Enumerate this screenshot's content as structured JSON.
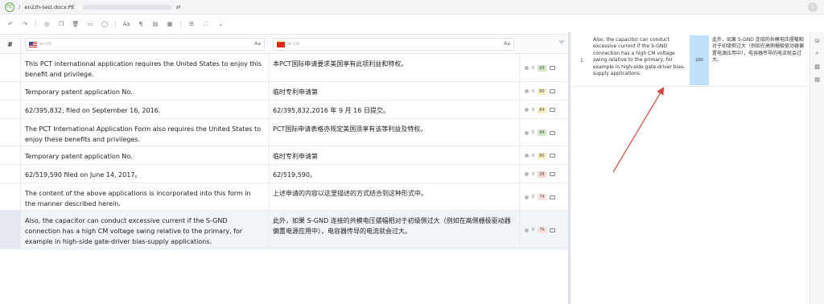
{
  "header": {
    "logo_text": "PE",
    "separator": "/",
    "filename": "en2zh-test.docx:PE",
    "refresh_icon": "refresh-icon",
    "avatar_text": "E"
  },
  "toolbar": {
    "icons": [
      "undo-icon",
      "redo-icon",
      "check-circle-icon",
      "copy-icon",
      "delete-icon",
      "tag-icon",
      "comment-icon",
      "font-case-icon",
      "paragraph-icon",
      "filter-doc-icon",
      "grid-icon",
      "list-filter-icon",
      "fullscreen-icon",
      "chevron-down-icon"
    ],
    "glyphs": [
      "↶",
      "↷",
      "◎",
      "❐",
      "🗑",
      "▭",
      "◯",
      "Aa",
      "¶",
      "▤",
      "▦",
      "☰",
      "⛶",
      "⌄"
    ]
  },
  "grid": {
    "num_header": "#",
    "source_lang": "en-US",
    "target_lang": "zh-CN",
    "case_toggle": "Aa",
    "rows": [
      {
        "source": "This PCT international application requires the United States to enjoy this benefit and privilege.",
        "target": "本PCT国际申请要求美国享有此项利益和特权。",
        "score": "93",
        "color": "#cfe8c6",
        "comments": "0"
      },
      {
        "source": "Temporary patent application No.",
        "target": "临时专利申请第",
        "score": "80",
        "color": "#f7eec3",
        "comments": "0"
      },
      {
        "source": "62/395,832, filed on September 16, 2016.",
        "target": "62/395,832,2016 年 9 月 16 日提交。",
        "score": "84",
        "color": "#f3edc1",
        "comments": "0"
      },
      {
        "source": "The PCT International Application Form also requires the United States to enjoy these benefits and privileges.",
        "target": "PCT国际申请表格亦规定美国须享有该等利益及特权。",
        "score": "94",
        "color": "#cfe8c6",
        "comments": "0"
      },
      {
        "source": "Temporary patent application No.",
        "target": "临时专利申请第",
        "score": "80",
        "color": "#f7eec3",
        "comments": "0"
      },
      {
        "source": "62/519,590 filed on June 14, 2017。",
        "target": "62/519,590。",
        "score": "28",
        "color": "#f7d6d4",
        "comments": "0"
      },
      {
        "source": "The content of the above applications is incorporated into this form in the manner described herein.",
        "target": "上述申请的内容以这里描述的方式结合到这种形式中。",
        "score": "74",
        "color": "#f9e0dd",
        "comments": "0"
      },
      {
        "source": "Also, the capacitor can conduct excessive current if the S-GND connection has a high CM voltage swing relative to the primary, for example in high-side gate-driver bias-supply applications.",
        "target": "此外，如果 S-GND 连接的共模电压摆幅相对于初级侧过大（例如在高侧栅极驱动器偏置电源应用中），电容器传导的电流就会过大。",
        "score": "76",
        "color": "#f9e0dd",
        "comments": "0"
      }
    ]
  },
  "tm_panel": {
    "index": "1",
    "source": "Also, the capacitor can conduct excessive current if the S-GND connection has a high CM voltage swing relative to the primary, for example in high-side gate-driver bias-supply applications.",
    "score": "100",
    "target": "此外，如果 S-GND 连接的共模电压摆幅相对于初级侧过大（例如在高侧栅极驱动器偏置电源应用中），电容器传导的电流就会过大。"
  },
  "sidebar": {
    "icons": [
      "database-icon",
      "search-doc-icon",
      "glossary-icon",
      "document-icon"
    ],
    "glyphs": [
      "⛁",
      "⌕",
      "▧",
      "▤"
    ]
  },
  "annotation": {
    "arrow_color": "#d9463a"
  }
}
